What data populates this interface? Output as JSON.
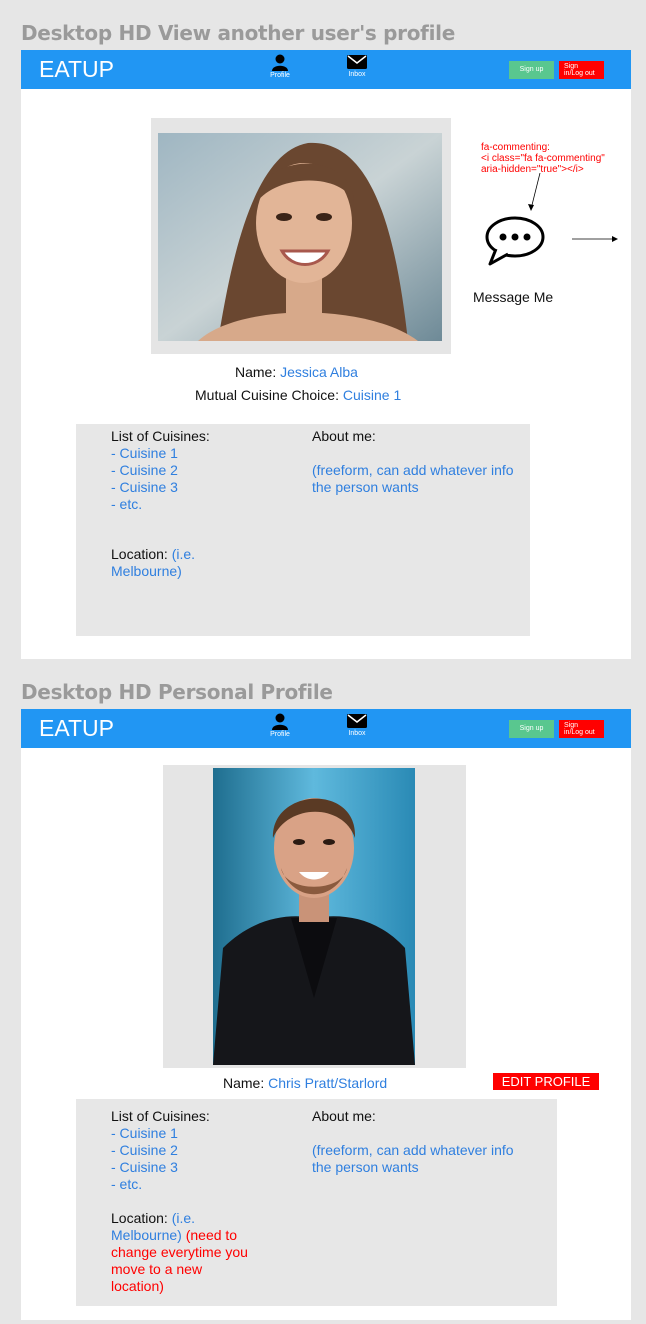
{
  "frame1": {
    "title": "Desktop HD View another user's profile",
    "nav": {
      "brand": "EATUP",
      "profile_label": "Profile",
      "inbox_label": "Inbox",
      "signup_label": "Sign up",
      "signin_label": "Sign in/Log out"
    },
    "name_label": "Name: ",
    "name_value": "Jessica Alba",
    "mutual_label": "Mutual Cuisine Choice: ",
    "mutual_value": "Cuisine 1",
    "annotation": "fa-commenting:\n<i class=\"fa fa-commenting\" aria-hidden=\"true\"></i>",
    "message_label": "Message Me",
    "cuisines_label": "List of Cuisines:",
    "cuisines": [
      "- Cuisine 1",
      "- Cuisine 2",
      "- Cuisine 3",
      "- etc."
    ],
    "about_label": "About me:",
    "about_text": "(freeform, can add whatever info the person wants",
    "location_label": "Location: ",
    "location_value": "(i.e. Melbourne)"
  },
  "frame2": {
    "title": "Desktop HD Personal Profile",
    "nav": {
      "brand": "EATUP",
      "profile_label": "Profile",
      "inbox_label": "Inbox",
      "signup_label": "Sign up",
      "signin_label": "Sign in/Log out"
    },
    "name_label": "Name: ",
    "name_value": "Chris Pratt/Starlord",
    "edit_label": "EDIT PROFILE",
    "cuisines_label": "List of Cuisines:",
    "cuisines": [
      "- Cuisine 1",
      "- Cuisine 2",
      "- Cuisine 3",
      "- etc."
    ],
    "about_label": "About me:",
    "about_text": "(freeform, can add whatever info the person wants",
    "location_label": "Location: ",
    "location_value": "(i.e. Melbourne) ",
    "location_note": "(need to change everytime you move to a new location)"
  },
  "colors": {
    "nav": "#2196f3",
    "signup": "#59c78f",
    "signin": "#ff0000",
    "link": "#2f7fdf",
    "edit": "#ff0000"
  }
}
